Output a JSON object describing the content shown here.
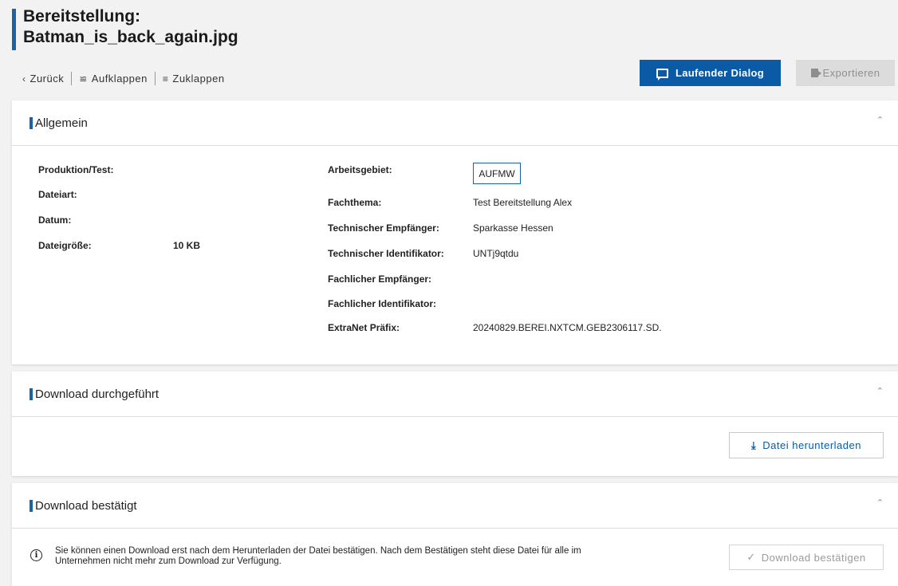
{
  "header": {
    "title_line1": "Bereitstellung:",
    "title_line2": "Batman_is_back_again.jpg"
  },
  "subnav": {
    "back": "Zurück",
    "expand": "Aufklappen",
    "collapse": "Zuklappen"
  },
  "actions": {
    "dialog": "Laufender Dialog",
    "export": "Exportieren"
  },
  "colors": {
    "accent": "#1a64a4",
    "primary_button": "#0a5aa6"
  },
  "general": {
    "title": "Allgemein",
    "left": [
      {
        "label": "Produktion/Test:",
        "value": ""
      },
      {
        "label": "Dateiart:",
        "value": ""
      },
      {
        "label": "Datum:",
        "value": ""
      },
      {
        "label": "Dateigröße:",
        "value": "10 KB"
      }
    ],
    "right": [
      {
        "label": "Arbeitsgebiet:",
        "value": "AUFMW"
      },
      {
        "label": "Fachthema:",
        "value": "Test Bereitstellung Alex"
      },
      {
        "label": "Technischer Empfänger:",
        "value": "Sparkasse Hessen"
      },
      {
        "label": "Technischer Identifikator:",
        "value": "UNTj9qtdu"
      },
      {
        "label": "Fachlicher Empfänger:",
        "value": ""
      },
      {
        "label": "Fachlicher Identifikator:",
        "value": ""
      },
      {
        "label": "ExtraNet Präfix:",
        "value": "20240829.BEREI.NXTCM.GEB2306117.SD."
      }
    ]
  },
  "download_done": {
    "title": "Download durchgeführt",
    "button": "Datei herunterladen"
  },
  "download_confirmed": {
    "title": "Download bestätigt",
    "info_line1": "Sie können einen Download erst nach dem Herunterladen der Datei bestätigen. Nach dem Bestätigen steht diese Datei für alle im",
    "info_line2": "Unternehmen nicht mehr zum Download zur Verfügung.",
    "button": "Download bestätigen"
  }
}
